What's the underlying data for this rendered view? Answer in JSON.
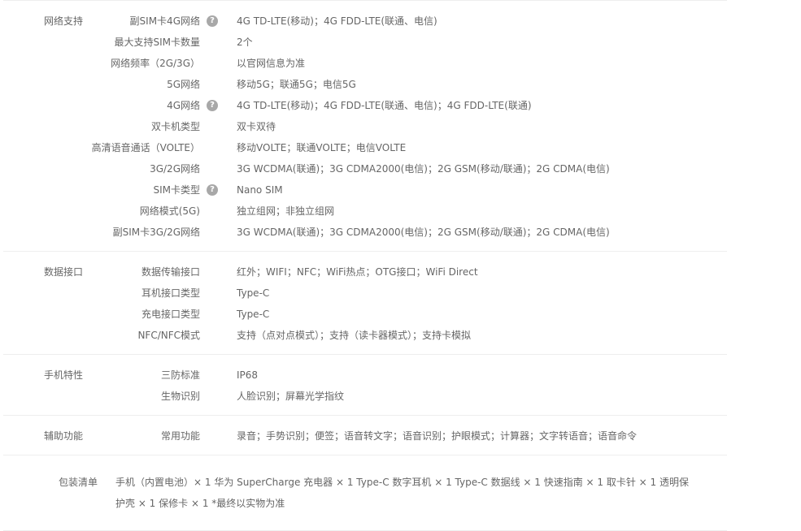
{
  "groups": [
    {
      "title": "网络支持",
      "rows": [
        {
          "label": "副SIM卡4G网络",
          "help": true,
          "value": "4G TD-LTE(移动)；4G FDD-LTE(联通、电信)"
        },
        {
          "label": "最大支持SIM卡数量",
          "help": false,
          "value": "2个"
        },
        {
          "label": "网络频率（2G/3G）",
          "help": false,
          "value": "以官网信息为准"
        },
        {
          "label": "5G网络",
          "help": false,
          "value": "移动5G；联通5G；电信5G"
        },
        {
          "label": "4G网络",
          "help": true,
          "value": "4G TD-LTE(移动)；4G FDD-LTE(联通、电信)；4G FDD-LTE(联通)"
        },
        {
          "label": "双卡机类型",
          "help": false,
          "value": "双卡双待"
        },
        {
          "label": "高清语音通话（VOLTE）",
          "help": false,
          "value": "移动VOLTE；联通VOLTE；电信VOLTE"
        },
        {
          "label": "3G/2G网络",
          "help": false,
          "value": "3G WCDMA(联通)；3G CDMA2000(电信)；2G GSM(移动/联通)；2G CDMA(电信)"
        },
        {
          "label": "SIM卡类型",
          "help": true,
          "value": "Nano SIM"
        },
        {
          "label": "网络模式(5G)",
          "help": false,
          "value": "独立组网；非独立组网"
        },
        {
          "label": "副SIM卡3G/2G网络",
          "help": false,
          "value": "3G WCDMA(联通)；3G CDMA2000(电信)；2G GSM(移动/联通)；2G CDMA(电信)"
        }
      ]
    },
    {
      "title": "数据接口",
      "rows": [
        {
          "label": "数据传输接口",
          "help": false,
          "value": "红外；WIFI；NFC；WiFi热点；OTG接口；WiFi Direct"
        },
        {
          "label": "耳机接口类型",
          "help": false,
          "value": "Type-C"
        },
        {
          "label": "充电接口类型",
          "help": false,
          "value": "Type-C"
        },
        {
          "label": "NFC/NFC模式",
          "help": false,
          "value": "支持（点对点模式）；支持（读卡器模式）；支持卡模拟"
        }
      ]
    },
    {
      "title": "手机特性",
      "rows": [
        {
          "label": "三防标准",
          "help": false,
          "value": "IP68"
        },
        {
          "label": "生物识别",
          "help": false,
          "value": "人脸识别；屏幕光学指纹"
        }
      ]
    },
    {
      "title": "辅助功能",
      "rows": [
        {
          "label": "常用功能",
          "help": false,
          "value": "录音；手势识别；便签；语音转文字；语音识别；护眼模式；计算器；文字转语音；语音命令"
        }
      ]
    }
  ],
  "help_icon_glyph": "?",
  "package": {
    "title": "包装清单",
    "content": "手机（内置电池）× 1 华为 SuperCharge 充电器 × 1 Type-C 数字耳机 × 1 Type-C 数据线 × 1 快速指南 × 1 取卡针 × 1 透明保护壳 × 1 保修卡 × 1 *最终以实物为准"
  }
}
